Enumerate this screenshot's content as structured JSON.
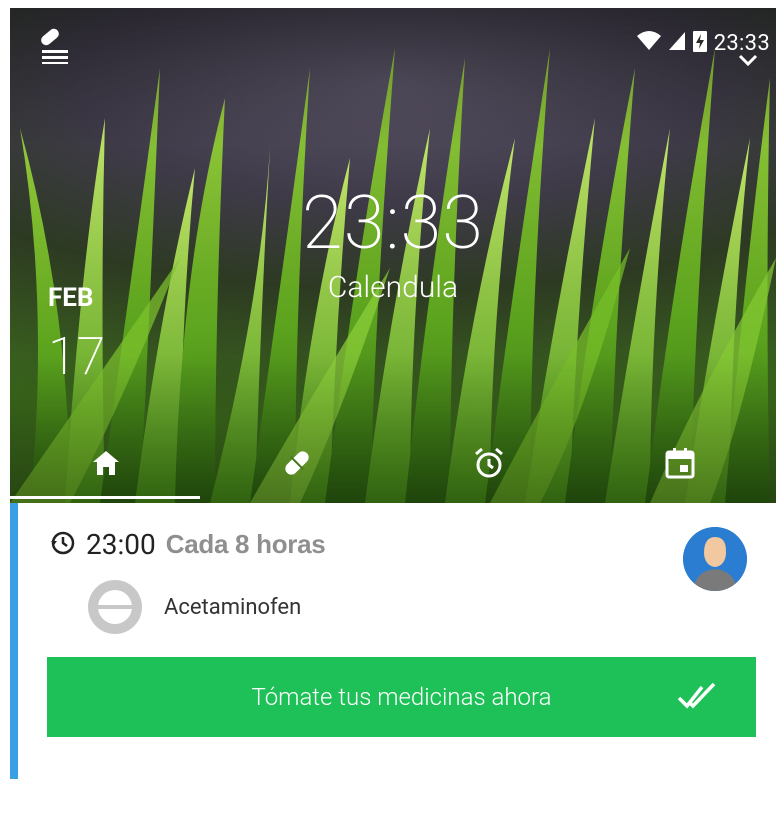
{
  "status_bar": {
    "time": "23:33"
  },
  "header": {
    "clock": "23:33",
    "subtitle": "Calendula",
    "date_month": "FEB",
    "date_day": "17"
  },
  "tabs": [
    {
      "icon": "home-icon"
    },
    {
      "icon": "pill-icon"
    },
    {
      "icon": "alarm-clock-icon"
    },
    {
      "icon": "calendar-icon"
    }
  ],
  "schedule_card": {
    "time": "23:00",
    "frequency": "Cada 8 horas",
    "medicine": "Acetaminofen",
    "action_button": "Tómate tus medicinas ahora"
  },
  "colors": {
    "accent_bar": "#3aa0e5",
    "action_green": "#1ec157",
    "avatar_blue": "#2a7dd0"
  }
}
